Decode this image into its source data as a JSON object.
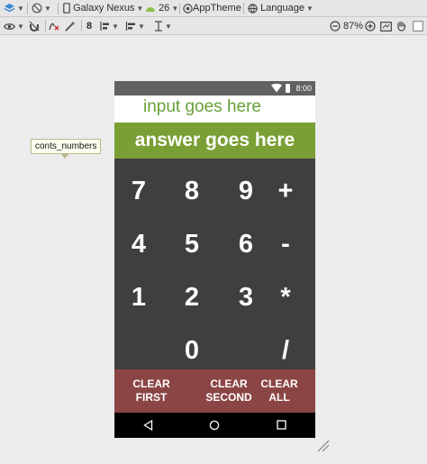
{
  "toolbar_top": {
    "layers_icon": "layers-icon",
    "rotate_icon": "no-rotate-icon",
    "device_label": "Galaxy Nexus",
    "api_label": "26",
    "theme_label": "AppTheme",
    "language_label": "Language"
  },
  "toolbar_bottom": {
    "text_size": "8",
    "zoom_label": "87%"
  },
  "tooltip": {
    "text": "conts_numbers"
  },
  "phone": {
    "status_time": "8:00",
    "input_text": "input goes here",
    "answer_text": "answer goes here",
    "keys": [
      "7",
      "8",
      "9",
      "+",
      "4",
      "5",
      "6",
      "-",
      "1",
      "2",
      "3",
      "*",
      "0",
      "/"
    ],
    "clear_first": [
      "CLEAR",
      "FIRST"
    ],
    "clear_second": [
      "CLEAR",
      "SECOND"
    ],
    "clear_all": [
      "CLEAR",
      "ALL"
    ]
  },
  "colors": {
    "accent_green": "#7a9f35",
    "input_green": "#689f38",
    "keypad_bg": "#3f3f3f",
    "clear_bg": "#8c4545"
  }
}
